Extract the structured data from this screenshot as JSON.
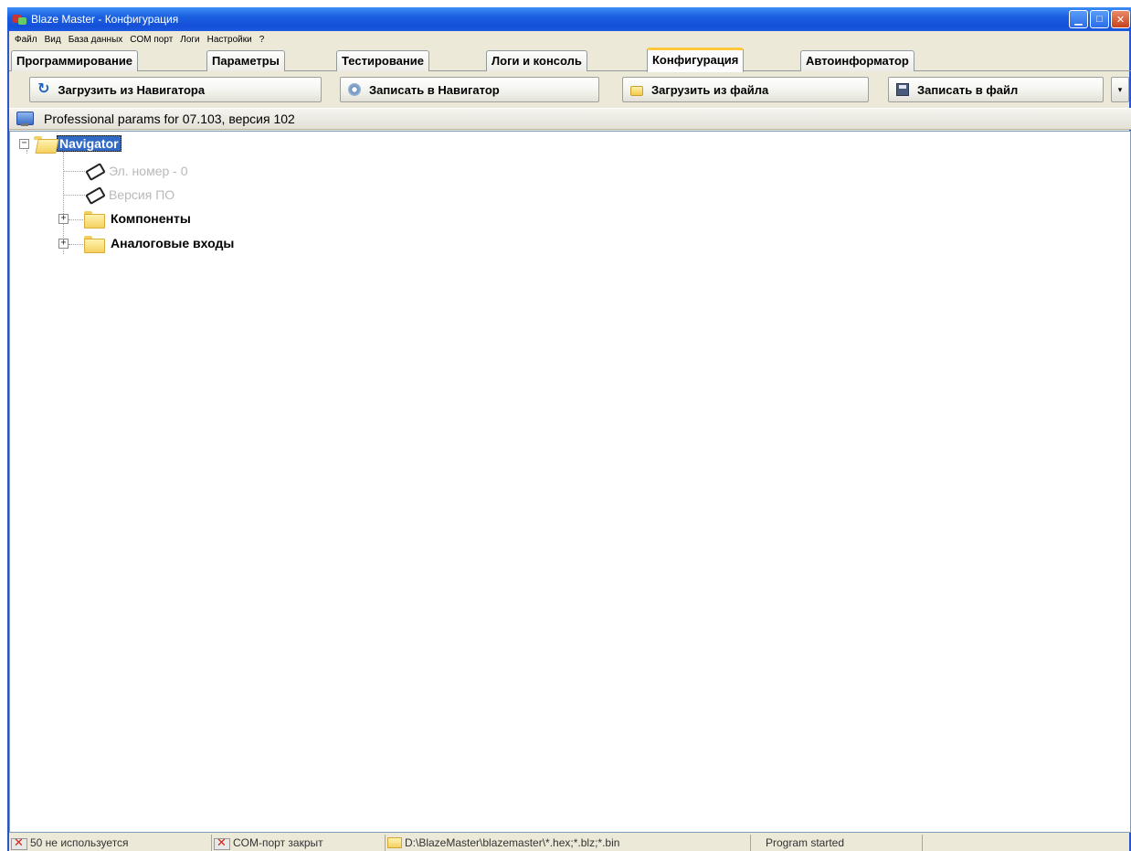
{
  "window": {
    "title": "Blaze Master - Конфигурация"
  },
  "menu": [
    "Файл",
    "Вид",
    "База данных",
    "COM порт",
    "Логи",
    "Настройки",
    "?"
  ],
  "tabs": [
    {
      "label": "Программирование",
      "active": false
    },
    {
      "label": "Параметры",
      "active": false
    },
    {
      "label": "Тестирование",
      "active": false
    },
    {
      "label": "Логи и консоль",
      "active": false
    },
    {
      "label": "Конфигурация",
      "active": true
    },
    {
      "label": "Автоинформатор",
      "active": false
    }
  ],
  "toolbar": {
    "load_from_navigator": "Загрузить из Навигатора",
    "write_to_navigator": "Записать в Навигатор",
    "load_from_file": "Загрузить из файла",
    "write_to_file": "Записать в файл",
    "dropdown": "▾"
  },
  "header": {
    "text": "Professional params for 07.103, версия 102"
  },
  "tree": {
    "root": {
      "label": "Navigator",
      "expander": "−"
    },
    "items": [
      {
        "label": "Эл. номер - 0",
        "disabled": true
      },
      {
        "label": "Версия ПО",
        "disabled": true
      },
      {
        "label": "Компоненты",
        "expander": "+"
      },
      {
        "label": "Аналоговые входы",
        "expander": "+"
      }
    ]
  },
  "statusbar": {
    "panel1": "50 не используется",
    "panel2": "COM-порт закрыт",
    "panel3": "D:\\BlazeMaster\\blazemaster\\*.hex;*.blz;*.bin",
    "panel4": "Program started"
  },
  "colors": {
    "titlebar": "#1550d8",
    "selection": "#316ac5",
    "active_tab_accent": "#ffc83c"
  }
}
